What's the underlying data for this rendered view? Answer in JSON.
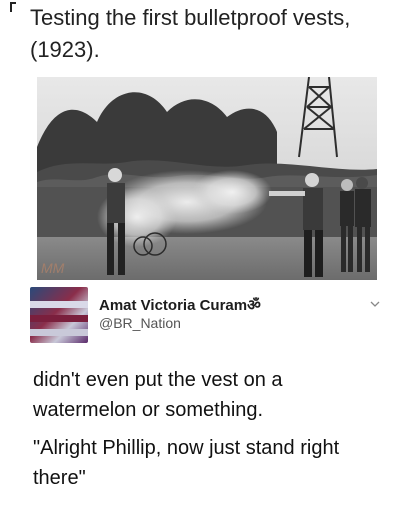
{
  "caption": {
    "line1": "Testing the first bulletproof vests,",
    "line2": "(1923)."
  },
  "tweet": {
    "display_name": "Amat Victoria Curam",
    "name_glyph": "ॐ",
    "handle": "@BR_Nation"
  },
  "body": {
    "p1_line1": "didn't even put the vest on a",
    "p1_line2": "watermelon or something.",
    "p2_line1": "\"Alright Phillip, now just stand right",
    "p2_line2": "there\""
  },
  "icons": {
    "chevron": "chevron-down-icon",
    "corner": "crop-corner-icon"
  }
}
